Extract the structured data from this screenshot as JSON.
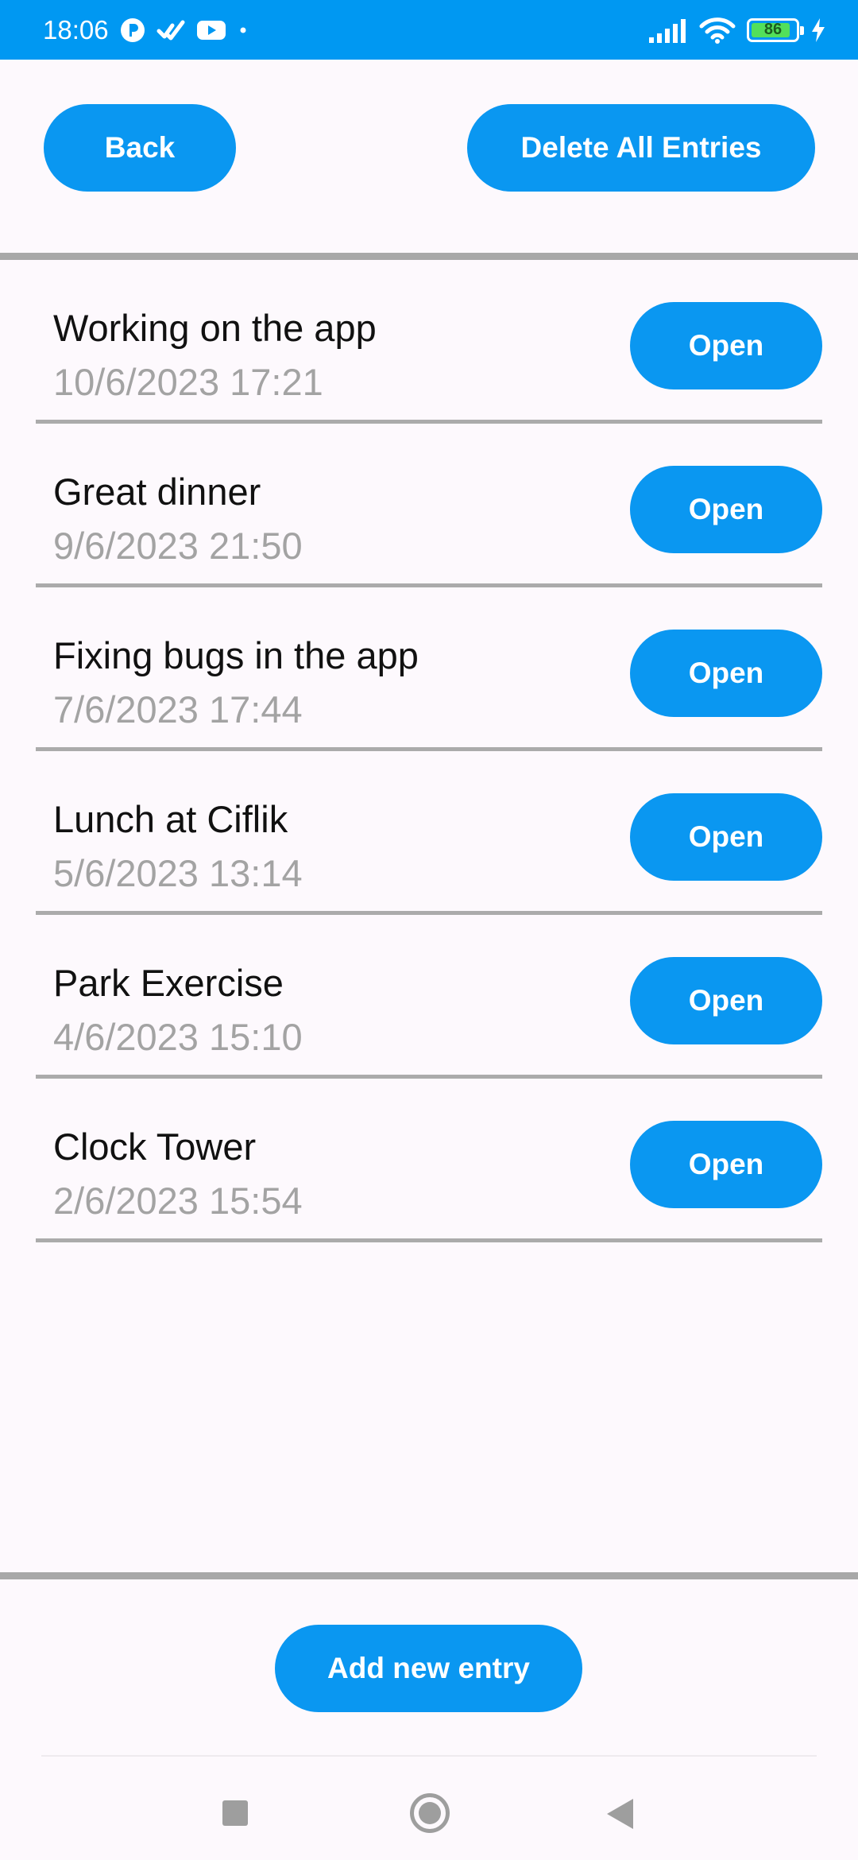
{
  "status_bar": {
    "time": "18:06",
    "left_icons": [
      "p-circle-icon",
      "check-badge-icon",
      "youtube-icon",
      "dot-icon"
    ],
    "right_icons": [
      "signal-icon",
      "wifi-icon",
      "battery-icon",
      "charging-bolt-icon"
    ],
    "battery_level": "86"
  },
  "header": {
    "back_label": "Back",
    "delete_all_label": "Delete All Entries"
  },
  "entries": [
    {
      "title": "Working on the app",
      "date": "10/6/2023 17:21",
      "open_label": "Open"
    },
    {
      "title": "Great dinner",
      "date": "9/6/2023 21:50",
      "open_label": "Open"
    },
    {
      "title": "Fixing bugs in the app",
      "date": "7/6/2023 17:44",
      "open_label": "Open"
    },
    {
      "title": "Lunch at Ciflik",
      "date": "5/6/2023 13:14",
      "open_label": "Open"
    },
    {
      "title": "Park Exercise",
      "date": "4/6/2023 15:10",
      "open_label": "Open"
    },
    {
      "title": "Clock Tower",
      "date": "2/6/2023 15:54",
      "open_label": "Open"
    }
  ],
  "footer": {
    "add_label": "Add new entry"
  },
  "colors": {
    "accent": "#0a97f1",
    "status_bar": "#0098f2",
    "divider": "#ababab",
    "date_text": "#a3a3a3"
  }
}
